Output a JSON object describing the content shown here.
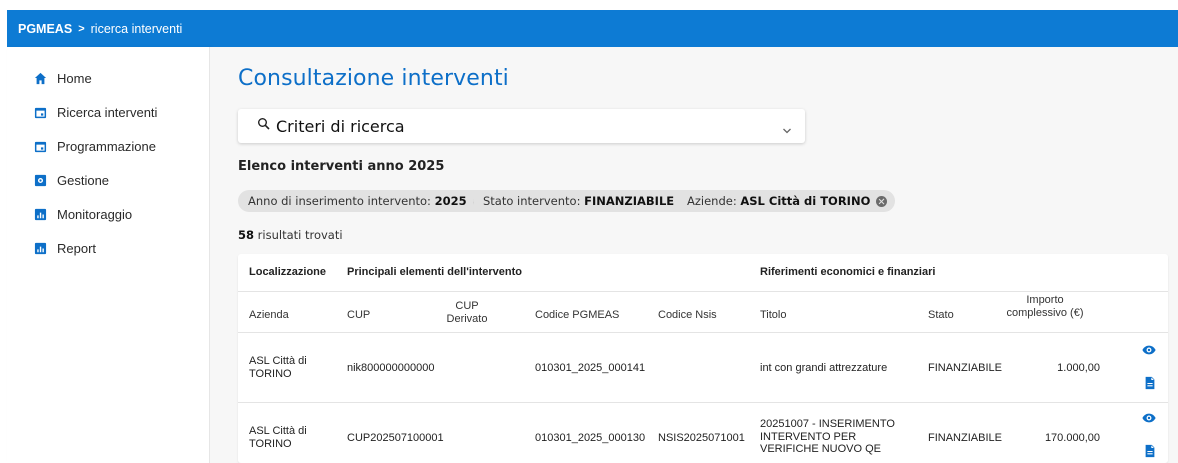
{
  "breadcrumb": {
    "app": "PGMEAS",
    "separator": ">",
    "current": "ricerca interventi"
  },
  "sidebar": {
    "items": [
      {
        "label": "Home",
        "icon": "home-icon"
      },
      {
        "label": "Ricerca interventi",
        "icon": "calendar-icon"
      },
      {
        "label": "Programmazione",
        "icon": "calendar-icon"
      },
      {
        "label": "Gestione",
        "icon": "settings-icon"
      },
      {
        "label": "Monitoraggio",
        "icon": "chart-icon"
      },
      {
        "label": "Report",
        "icon": "chart-icon"
      }
    ]
  },
  "main": {
    "title": "Consultazione interventi",
    "criteria": {
      "label": "Criteri di ricerca",
      "icon": "search-icon"
    },
    "list_title": "Elenco interventi anno 2025",
    "filters": [
      {
        "label": "Anno di inserimento intervento:",
        "value": "2025"
      },
      {
        "label": "Stato intervento:",
        "value": "FINANZIABILE"
      },
      {
        "label": "Aziende:",
        "value": "ASL Città di TORINO"
      }
    ],
    "results": {
      "count": "58",
      "text": "risultati trovati"
    }
  },
  "table": {
    "groups": [
      "Localizzazione",
      "Principali elementi dell'intervento",
      "Riferimenti economici e finanziari"
    ],
    "columns": [
      "Azienda",
      "CUP",
      "CUP Derivato",
      "Codice PGMEAS",
      "Codice Nsis",
      "Titolo",
      "Stato",
      "Importo complessivo (€)"
    ],
    "rows": [
      {
        "azienda": "ASL Città di TORINO",
        "cup": "nik800000000000",
        "cup_derivato": "",
        "codice_pgmeas": "010301_2025_000141",
        "codice_nsis": "",
        "titolo": "int con grandi attrezzature",
        "stato": "FINANZIABILE",
        "importo": "1.000,00"
      },
      {
        "azienda": "ASL Città di TORINO",
        "cup": "CUP202507100001",
        "cup_derivato": "",
        "codice_pgmeas": "010301_2025_000130",
        "codice_nsis": "NSIS2025071001",
        "titolo": "20251007 - INSERIMENTO INTERVENTO PER VERIFICHE NUOVO QE",
        "stato": "FINANZIABILE",
        "importo": "170.000,00"
      }
    ]
  },
  "colors": {
    "brand": "#0d7bd4",
    "accent": "#0d6fc8",
    "chip_bg": "#e2e2e2"
  }
}
